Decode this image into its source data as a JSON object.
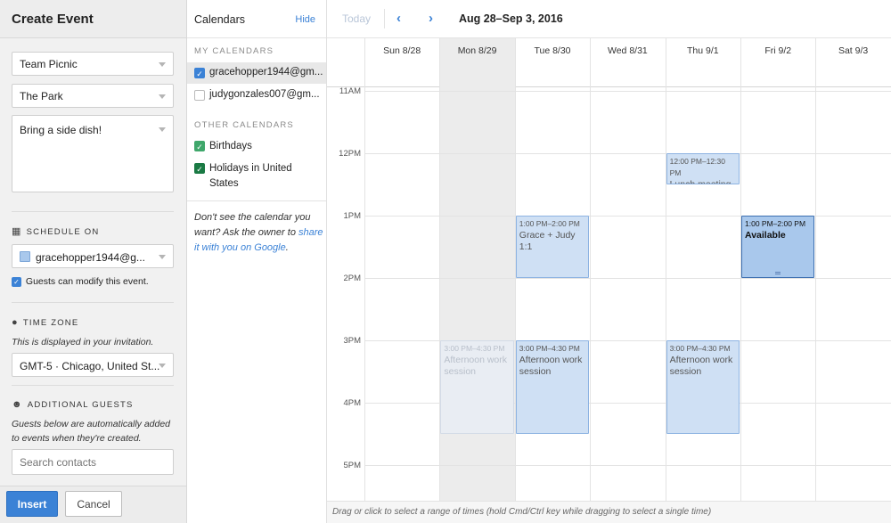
{
  "left_panel": {
    "title": "Create Event",
    "title_field": "Team Picnic",
    "location_field": "The Park",
    "description_field": "Bring a side dish!",
    "schedule_label": "SCHEDULE ON",
    "schedule_calendar": "gracehopper1944@g...",
    "schedule_color": "#a9c8ec",
    "guests_modify": "Guests can modify this event.",
    "timezone_label": "TIME ZONE",
    "timezone_note": "This is displayed in your invitation.",
    "timezone_value": "GMT-5 · Chicago, United St...",
    "guests_label": "ADDITIONAL GUESTS",
    "guests_note": "Guests below are automatically added to events when they're created.",
    "search_placeholder": "Search contacts",
    "insert_label": "Insert",
    "cancel_label": "Cancel"
  },
  "calendars_panel": {
    "title": "Calendars",
    "hide_label": "Hide",
    "my_calendars_label": "MY CALENDARS",
    "my_calendars": [
      {
        "name": "gracehopper1944@gm...",
        "checked": true,
        "color": "#3b82d6"
      },
      {
        "name": "judygonzales007@gm...",
        "checked": false,
        "color": "#ffffff"
      }
    ],
    "other_calendars_label": "OTHER CALENDARS",
    "other_calendars": [
      {
        "name": "Birthdays",
        "checked": true,
        "color": "#3fa76b"
      },
      {
        "name": "Holidays in United States",
        "checked": true,
        "color": "#1a7a44"
      }
    ],
    "note_text": "Don't see the calendar you want? Ask the owner to ",
    "note_link": "share it with you on Google",
    "note_end": "."
  },
  "toolbar": {
    "today_label": "Today",
    "prev_icon": "chevron-left-icon",
    "next_icon": "chevron-right-icon",
    "range": "Aug 28–Sep 3, 2016"
  },
  "days": [
    "Sun 8/28",
    "Mon 8/29",
    "Tue 8/30",
    "Wed 8/31",
    "Thu 9/1",
    "Fri 9/2",
    "Sat 9/3"
  ],
  "today_index": 1,
  "hours": [
    "11AM",
    "12PM",
    "1PM",
    "2PM",
    "3PM",
    "4PM",
    "5PM"
  ],
  "first_hour": 11,
  "events": [
    {
      "day": 4,
      "start": 12.0,
      "end": 12.5,
      "time": "12:00 PM–12:30 PM",
      "name": "Lunch meeting with Hugo",
      "style": "normal"
    },
    {
      "day": 2,
      "start": 13.0,
      "end": 14.0,
      "time": "1:00 PM–2:00 PM",
      "name": "Grace + Judy 1:1",
      "style": "normal"
    },
    {
      "day": 5,
      "start": 13.0,
      "end": 14.0,
      "time": "1:00 PM–2:00 PM",
      "name": "Available",
      "style": "selected"
    },
    {
      "day": 1,
      "start": 15.0,
      "end": 16.5,
      "time": "3:00 PM–4:30 PM",
      "name": "Afternoon work session",
      "style": "faded"
    },
    {
      "day": 2,
      "start": 15.0,
      "end": 16.5,
      "time": "3:00 PM–4:30 PM",
      "name": "Afternoon work session",
      "style": "normal"
    },
    {
      "day": 4,
      "start": 15.0,
      "end": 16.5,
      "time": "3:00 PM–4:30 PM",
      "name": "Afternoon work session",
      "style": "normal"
    }
  ],
  "status_text": "Drag or click to select a range of times (hold Cmd/Ctrl key while dragging to select a single time)"
}
